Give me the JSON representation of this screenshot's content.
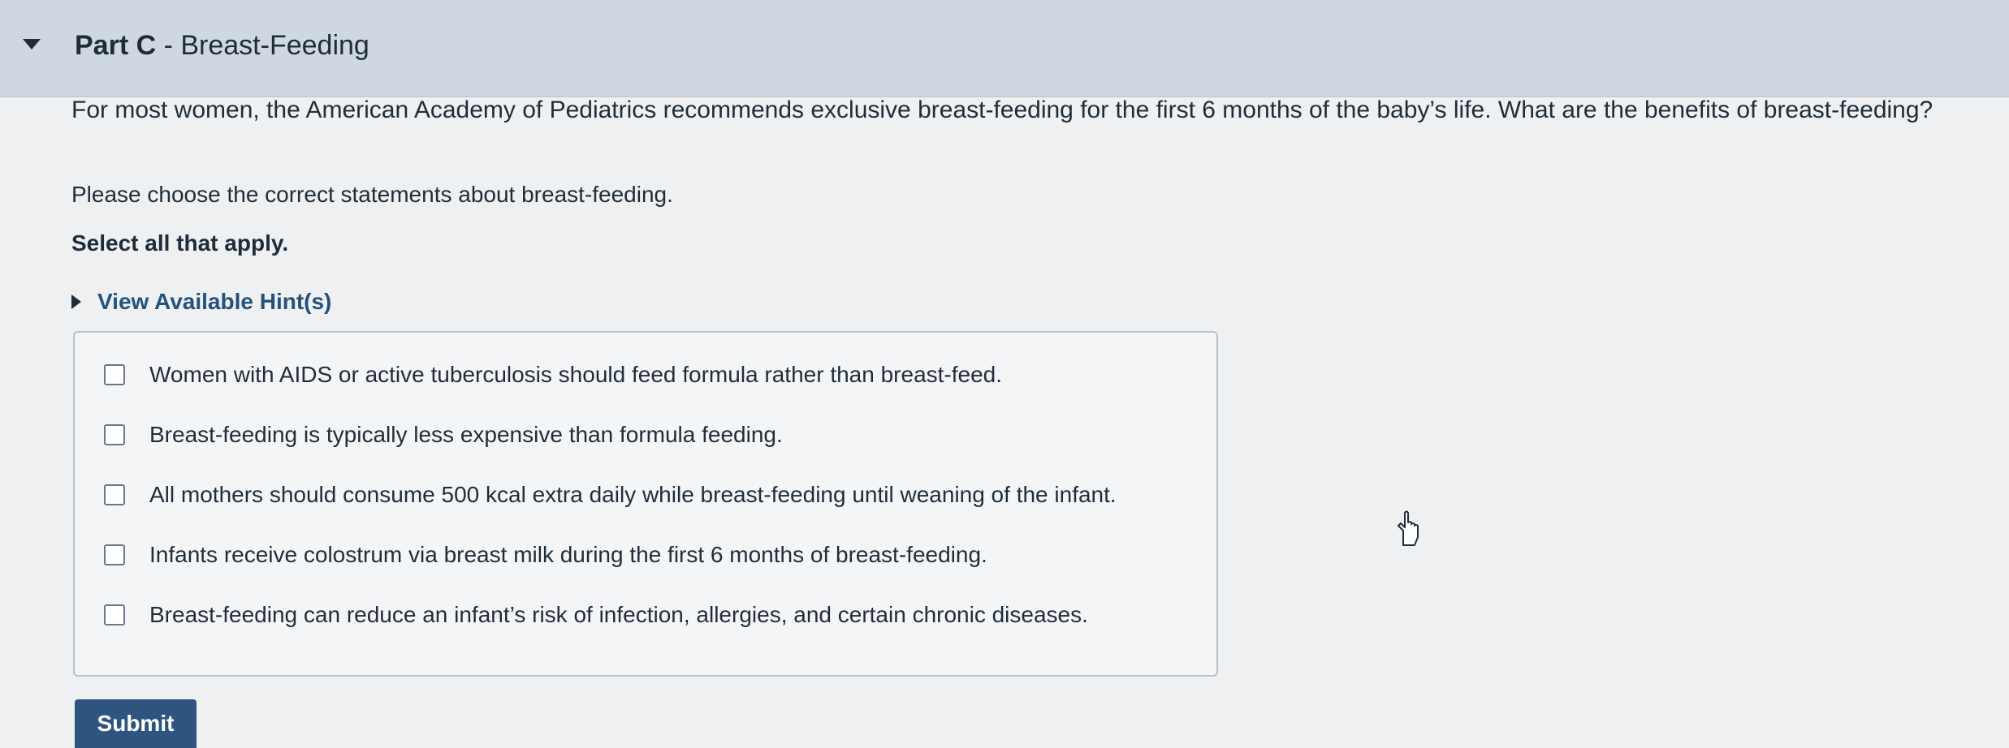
{
  "part": {
    "label": "Part C",
    "separator": " - ",
    "title": "Breast-Feeding"
  },
  "question": "For most women, the American Academy of Pediatrics recommends exclusive breast-feeding for the first 6 months of the baby’s life. What are the benefits of breast-feeding?",
  "instruction": "Please choose the correct statements about breast-feeding.",
  "select_all": "Select all that apply.",
  "hint": {
    "label": "View Available Hint(s)"
  },
  "options": [
    {
      "text": "Women with AIDS or active tuberculosis should feed formula rather than breast-feed.",
      "checked": false
    },
    {
      "text": "Breast-feeding is typically less expensive than formula feeding.",
      "checked": false
    },
    {
      "text": "All mothers should consume 500 kcal extra daily while breast-feeding until weaning of the infant.",
      "checked": false
    },
    {
      "text": "Infants receive colostrum via breast milk during the first 6 months of breast-feeding.",
      "checked": false
    },
    {
      "text": "Breast-feeding can reduce an infant’s risk of infection, allergies, and certain chronic diseases.",
      "checked": false
    }
  ],
  "submit": {
    "label": "Submit"
  },
  "colors": {
    "header_background": "#cfd8e1",
    "submit_background": "#2e5580",
    "hint_text": "#23527c"
  }
}
